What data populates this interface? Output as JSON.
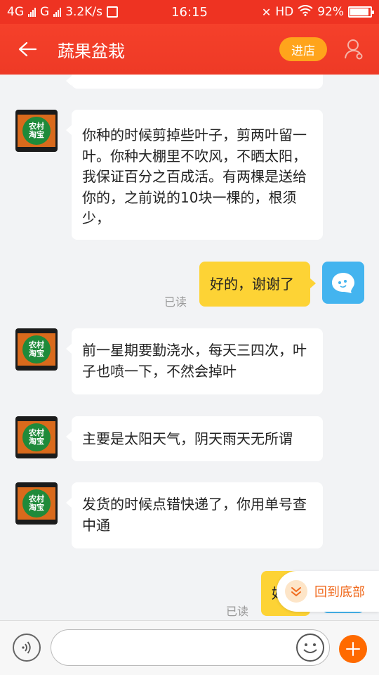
{
  "status_bar": {
    "network_left": "4G",
    "network_right": "G",
    "speed": "3.2K/s",
    "time": "16:15",
    "hd": "HD",
    "battery": "92%"
  },
  "header": {
    "title": "蔬果盆栽",
    "enter_shop_label": "进店"
  },
  "shop_avatar_text": [
    "农村",
    "淘宝"
  ],
  "messages": [
    {
      "from": "shop",
      "text": "你种的时候剪掉些叶子，剪两叶留一叶。你种大棚里不吹风，不晒太阳，我保证百分之百成活。有两棵是送给你的，之前说的10块一棵的，根须少，"
    },
    {
      "from": "me",
      "text": "好的，谢谢了",
      "status": "已读"
    },
    {
      "from": "shop",
      "text": "前一星期要勤浇水，每天三四次，叶子也喷一下，不然会掉叶"
    },
    {
      "from": "shop",
      "text": "主要是太阳天气，阴天雨天无所谓"
    },
    {
      "from": "shop",
      "text": "发货的时候点错快递了，你用单号查中通"
    },
    {
      "from": "me",
      "text": "好的",
      "status": "已读"
    }
  ],
  "back_to_bottom_label": "回到底部",
  "input": {
    "value": "",
    "placeholder": ""
  },
  "colors": {
    "header_red": "#ee3a26",
    "enter_orange": "#ffa41b",
    "my_bubble": "#fdd335",
    "plus_orange": "#ff6a00",
    "back_to_bottom_text": "#f06a1d"
  }
}
